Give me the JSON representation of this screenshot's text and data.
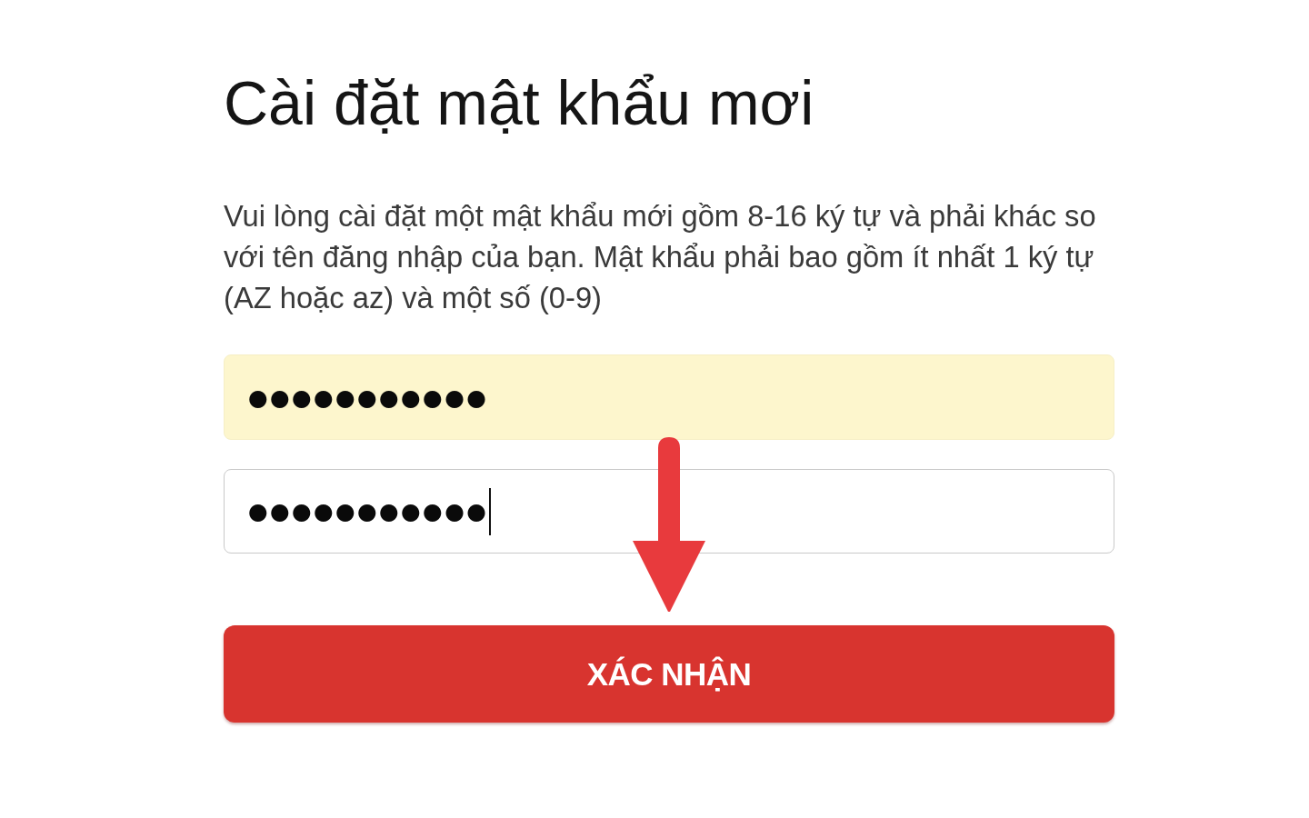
{
  "title": "Cài đặt mật khẩu mơi",
  "instructions": "Vui lòng cài đặt một mật khẩu mới gồm 8-16 ký tự và phải khác so với tên đăng nhập của bạn. Mật khẩu phải bao gồm ít nhất 1 ký tự (AZ hoặc az) và một số (0-9)",
  "password_fields": [
    {
      "value": "●●●●●●●●●●●",
      "highlighted": true,
      "focused": false
    },
    {
      "value": "●●●●●●●●●●●",
      "highlighted": false,
      "focused": true
    }
  ],
  "confirm_button": {
    "label": "XÁC NHẬN"
  }
}
